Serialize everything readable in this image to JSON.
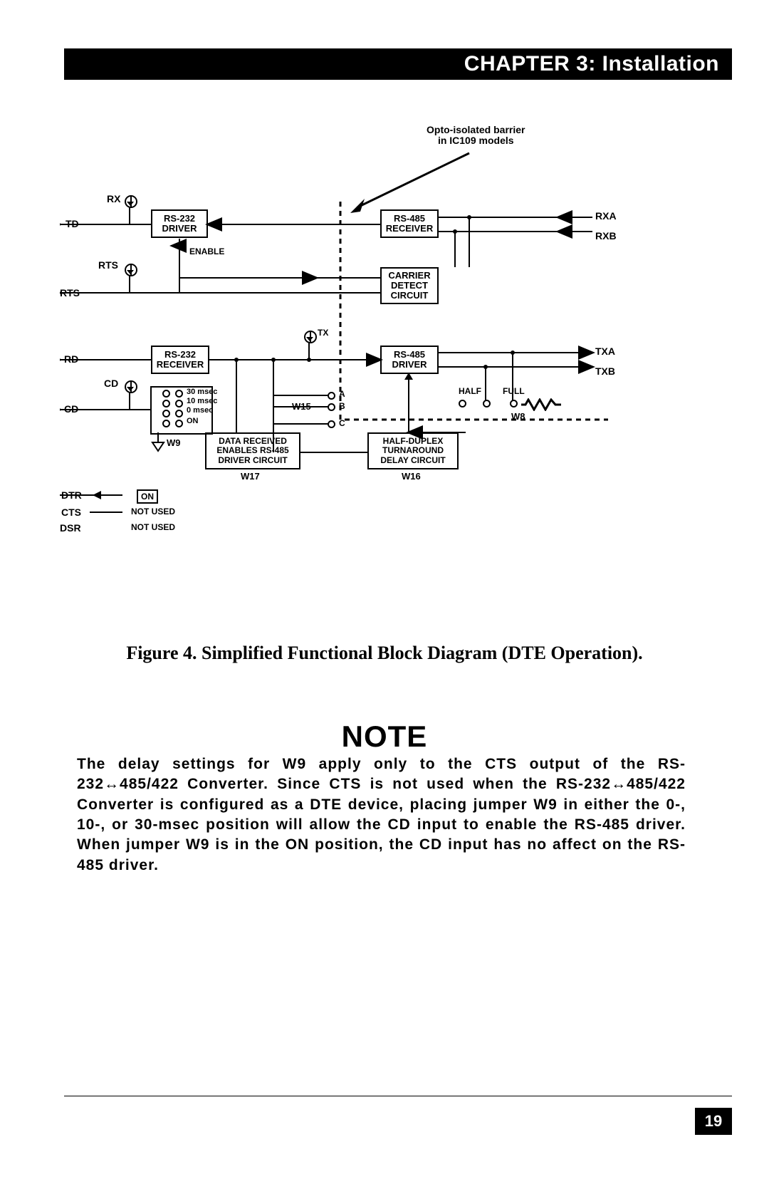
{
  "header": {
    "chapter_title": "CHAPTER 3: Installation"
  },
  "diagram": {
    "annotation_opto": "Opto-isolated barrier\nin IC109 models",
    "signals_left": {
      "TD": "TD",
      "RX": "RX",
      "RTS_top": "RTS",
      "RTS": "RTS",
      "RD": "RD",
      "CD_top": "CD",
      "CD": "CD",
      "DTR": "DTR",
      "CTS": "CTS",
      "DSR": "DSR",
      "NOT_USED": "NOT USED",
      "ON": "ON"
    },
    "signals_right": {
      "RXA": "RXA",
      "RXB": "RXB",
      "TXA": "TXA",
      "TXB": "TXB",
      "HALF": "HALF",
      "FULL": "FULL"
    },
    "blocks": {
      "rs232_driver": "RS-232\nDRIVER",
      "rs485_receiver": "RS-485\nRECEIVER",
      "carrier_detect": "CARRIER\nDETECT\nCIRCUIT",
      "rs232_receiver": "RS-232\nRECEIVER",
      "rs485_driver": "RS-485\nDRIVER",
      "data_received": "DATA RECEIVED\nENABLES RS-485\nDRIVER CIRCUIT",
      "half_duplex": "HALF-DUPLEX\nTURNAROUND\nDELAY CIRCUIT"
    },
    "mid_labels": {
      "ENABLE": "ENABLE",
      "TX": "TX",
      "A": "A",
      "B": "B",
      "C": "C"
    },
    "jumpers": {
      "W9": "W9",
      "W15": "W15",
      "W8": "W8",
      "W16": "W16",
      "W17": "W17",
      "msec30": "30 msec",
      "msec10": "10 msec",
      "msec0": "0 msec",
      "on": "ON"
    }
  },
  "figure_caption": "Figure 4.  Simplified Functional Block Diagram (DTE Operation).",
  "note": {
    "heading": "NOTE",
    "body": "The delay settings for W9 apply only to the CTS output of the RS-232↔485/422 Converter. Since CTS is not used when the RS-232↔485/422 Converter is configured as a DTE device, placing jumper W9 in either the 0-, 10-, or 30-msec position will allow the CD input to enable the RS-485 driver. When jumper W9 is in the ON position, the CD input has no affect on the RS-485 driver."
  },
  "page_number": "19"
}
